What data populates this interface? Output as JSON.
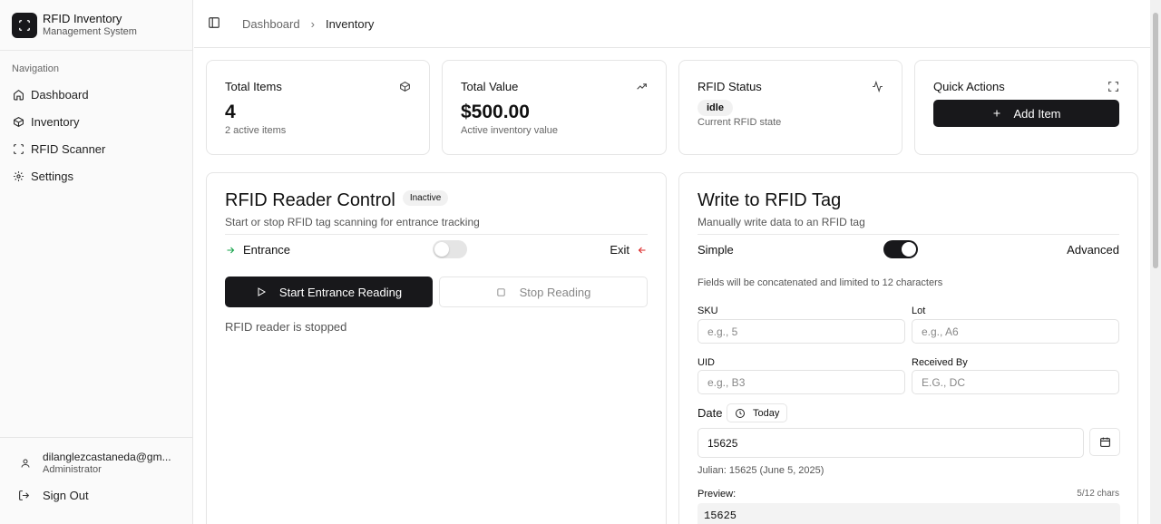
{
  "brand": {
    "title": "RFID Inventory",
    "subtitle": "Management System"
  },
  "sidebar": {
    "section_label": "Navigation",
    "items": [
      {
        "label": "Dashboard",
        "icon": "home-icon"
      },
      {
        "label": "Inventory",
        "icon": "package-icon"
      },
      {
        "label": "RFID Scanner",
        "icon": "scan-icon"
      },
      {
        "label": "Settings",
        "icon": "gear-icon"
      }
    ],
    "user": {
      "email": "dilanglezcastaneda@gm...",
      "role": "Administrator"
    },
    "signout_label": "Sign Out"
  },
  "header": {
    "breadcrumb": [
      "Dashboard",
      "Inventory"
    ]
  },
  "stats": {
    "total_items": {
      "title": "Total Items",
      "value": "4",
      "sub": "2 active items"
    },
    "total_value": {
      "title": "Total Value",
      "value": "$500.00",
      "sub": "Active inventory value"
    },
    "rfid_status": {
      "title": "RFID Status",
      "badge": "idle",
      "sub": "Current RFID state"
    },
    "quick_actions": {
      "title": "Quick Actions",
      "add_item_label": "Add Item"
    }
  },
  "reader": {
    "title": "RFID Reader Control",
    "status_badge": "Inactive",
    "description": "Start or stop RFID tag scanning for entrance tracking",
    "entrance_label": "Entrance",
    "exit_label": "Exit",
    "mode_toggle_on": false,
    "start_label": "Start Entrance Reading",
    "stop_label": "Stop Reading",
    "status_text": "RFID reader is stopped"
  },
  "writer": {
    "title": "Write to RFID Tag",
    "description": "Manually write data to an RFID tag",
    "simple_label": "Simple",
    "advanced_label": "Advanced",
    "mode_toggle_on": true,
    "hint": "Fields will be concatenated and limited to 12 characters",
    "sku": {
      "label": "SKU",
      "placeholder": "e.g., 5"
    },
    "lot": {
      "label": "Lot",
      "placeholder": "e.g., A6"
    },
    "uid": {
      "label": "UID",
      "placeholder": "e.g., B3"
    },
    "received_by": {
      "label": "Received By",
      "placeholder": "E.G., DC"
    },
    "date_label": "Date",
    "today_label": "Today",
    "date_value": "15625",
    "julian_text": "Julian: 15625 (June 5, 2025)",
    "preview_label": "Preview:",
    "char_count": "5/12 chars",
    "preview_value": "15625"
  },
  "colors": {
    "accent_dark": "#18181b",
    "entrance_green": "#16a34a",
    "exit_red": "#dc2626"
  }
}
